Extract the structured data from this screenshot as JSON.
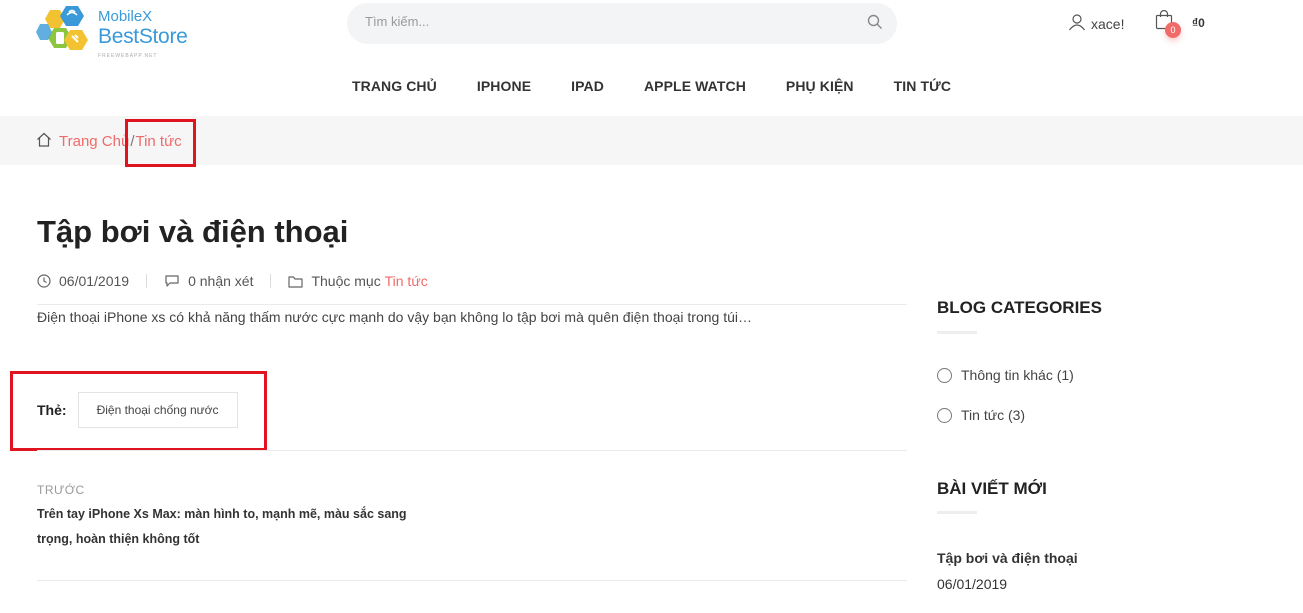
{
  "header": {
    "logo_line1": "MobileX",
    "logo_line2": "BestStore",
    "logo_line3": "FREEWEBAPP.NET",
    "search_placeholder": "Tìm kiếm...",
    "user_name": "xace!",
    "cart_count": "0",
    "cart_total": "₫0"
  },
  "nav": {
    "items": [
      "TRANG CHỦ",
      "IPHONE",
      "IPAD",
      "APPLE WATCH",
      "PHỤ KIỆN",
      "TIN TỨC"
    ]
  },
  "breadcrumb": {
    "home": "Trang Chủ",
    "separator": "/",
    "current": "Tin tức"
  },
  "article": {
    "title": "Tập bơi và điện thoại",
    "date": "06/01/2019",
    "comments": "0 nhận xét",
    "category_prefix": "Thuộc mục",
    "category": "Tin tức",
    "excerpt": "Điện thoại iPhone xs có khả năng thấm nước cực mạnh do vậy bạn không lo tập bơi mà quên điện thoại trong túi…",
    "tags_label": "Thẻ:",
    "tag": "Điện thoại chống nước",
    "prev_label": "TRƯỚC",
    "prev_title": "Trên tay iPhone Xs Max: màn hình to, mạnh mẽ, màu sắc sang trọng, hoàn thiện không tốt"
  },
  "sidebar": {
    "categories_heading": "BLOG CATEGORIES",
    "categories": [
      {
        "label": "Thông tin khác (1)"
      },
      {
        "label": "Tin tức (3)"
      }
    ],
    "recent_heading": "BÀI VIẾT MỚI",
    "recent_post_title": "Tập bơi và điện thoại",
    "recent_post_date": "06/01/2019"
  },
  "colors": {
    "accent": "#f06a6a",
    "highlight_box": "#e0141e",
    "logo_blue": "#3a9ad9"
  }
}
